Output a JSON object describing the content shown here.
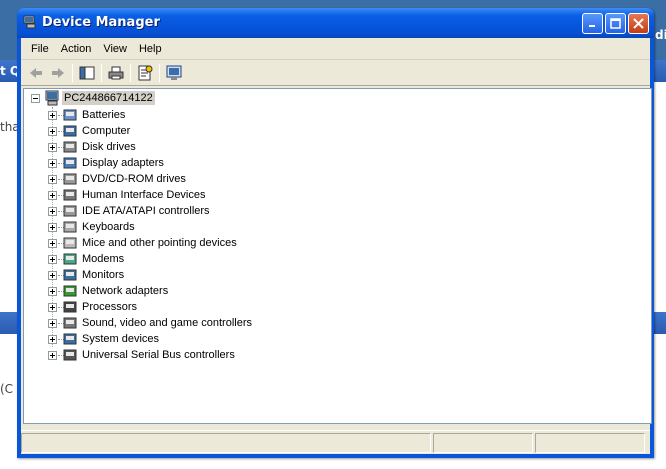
{
  "window": {
    "title": "Device Manager"
  },
  "menu": [
    "File",
    "Action",
    "View",
    "Help"
  ],
  "tree": {
    "root": "PC244866714122",
    "items": [
      {
        "label": "Batteries",
        "icon": "battery-icon"
      },
      {
        "label": "Computer",
        "icon": "computer-icon"
      },
      {
        "label": "Disk drives",
        "icon": "disk-drive-icon"
      },
      {
        "label": "Display adapters",
        "icon": "display-adapter-icon"
      },
      {
        "label": "DVD/CD-ROM drives",
        "icon": "cdrom-icon"
      },
      {
        "label": "Human Interface Devices",
        "icon": "hid-icon"
      },
      {
        "label": "IDE ATA/ATAPI controllers",
        "icon": "ide-controller-icon"
      },
      {
        "label": "Keyboards",
        "icon": "keyboard-icon"
      },
      {
        "label": "Mice and other pointing devices",
        "icon": "mouse-icon"
      },
      {
        "label": "Modems",
        "icon": "modem-icon"
      },
      {
        "label": "Monitors",
        "icon": "monitor-icon"
      },
      {
        "label": "Network adapters",
        "icon": "network-adapter-icon"
      },
      {
        "label": "Processors",
        "icon": "processor-icon"
      },
      {
        "label": "Sound, video and game controllers",
        "icon": "sound-icon"
      },
      {
        "label": "System devices",
        "icon": "system-device-icon"
      },
      {
        "label": "Universal Serial Bus controllers",
        "icon": "usb-icon"
      }
    ]
  },
  "background": {
    "fragments": [
      "t Q",
      "tha",
      "t Q",
      "(C",
      "di",
      "di"
    ]
  },
  "colors": {
    "titlebar": "#0755dd",
    "desktop": "#3a6ea5",
    "selection": "#d4d0c8"
  }
}
